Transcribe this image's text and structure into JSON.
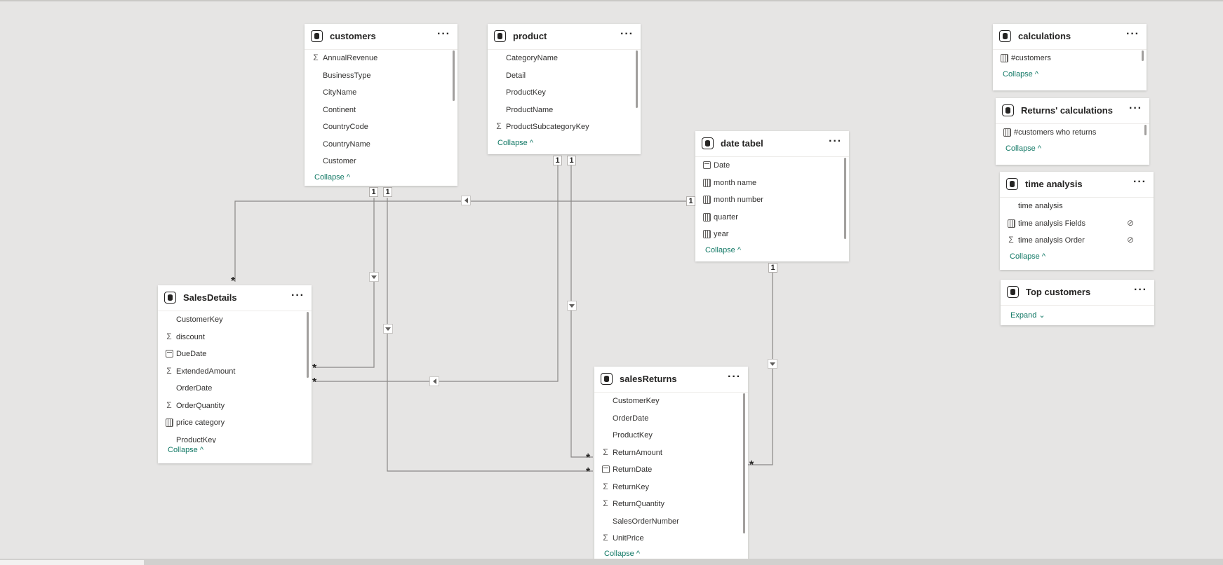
{
  "tables": {
    "customers": {
      "title": "customers",
      "fields": [
        {
          "name": "AnnualRevenue",
          "icon": "sigma"
        },
        {
          "name": "BusinessType",
          "icon": ""
        },
        {
          "name": "CityName",
          "icon": ""
        },
        {
          "name": "Continent",
          "icon": ""
        },
        {
          "name": "CountryCode",
          "icon": ""
        },
        {
          "name": "CountryName",
          "icon": ""
        },
        {
          "name": "Customer",
          "icon": ""
        }
      ],
      "toggle": "Collapse"
    },
    "product": {
      "title": "product",
      "fields": [
        {
          "name": "CategoryName",
          "icon": ""
        },
        {
          "name": "Detail",
          "icon": ""
        },
        {
          "name": "ProductKey",
          "icon": ""
        },
        {
          "name": "ProductName",
          "icon": ""
        },
        {
          "name": "ProductSubcategoryKey",
          "icon": "sigma"
        }
      ],
      "toggle": "Collapse"
    },
    "date_tabel": {
      "title": "date tabel",
      "fields": [
        {
          "name": "Date",
          "icon": "calendar"
        },
        {
          "name": "month name",
          "icon": "calc-column"
        },
        {
          "name": "month number",
          "icon": "calc-column"
        },
        {
          "name": "quarter",
          "icon": "calc-column"
        },
        {
          "name": "year",
          "icon": "calc-column"
        }
      ],
      "toggle": "Collapse"
    },
    "sales_details": {
      "title": "SalesDetails",
      "fields": [
        {
          "name": "CustomerKey",
          "icon": ""
        },
        {
          "name": "discount",
          "icon": "sigma"
        },
        {
          "name": "DueDate",
          "icon": "calendar"
        },
        {
          "name": "ExtendedAmount",
          "icon": "sigma"
        },
        {
          "name": "OrderDate",
          "icon": ""
        },
        {
          "name": "OrderQuantity",
          "icon": "sigma"
        },
        {
          "name": "price category",
          "icon": "calc-column"
        },
        {
          "name": "ProductKey",
          "icon": ""
        }
      ],
      "toggle": "Collapse"
    },
    "sales_returns": {
      "title": "salesReturns",
      "fields": [
        {
          "name": "CustomerKey",
          "icon": ""
        },
        {
          "name": "OrderDate",
          "icon": ""
        },
        {
          "name": "ProductKey",
          "icon": ""
        },
        {
          "name": "ReturnAmount",
          "icon": "sigma"
        },
        {
          "name": "ReturnDate",
          "icon": "calendar"
        },
        {
          "name": "ReturnKey",
          "icon": "sigma"
        },
        {
          "name": "ReturnQuantity",
          "icon": "sigma"
        },
        {
          "name": "SalesOrderNumber",
          "icon": ""
        },
        {
          "name": "UnitPrice",
          "icon": "sigma"
        }
      ],
      "toggle": "Collapse"
    },
    "calculations": {
      "title": "calculations",
      "fields": [
        {
          "name": "#customers",
          "icon": "measure"
        }
      ],
      "toggle": "Collapse"
    },
    "returns_calculations": {
      "title": "Returns' calculations",
      "fields": [
        {
          "name": "#customers who returns",
          "icon": "measure"
        }
      ],
      "toggle": "Collapse"
    },
    "time_analysis": {
      "title": "time analysis",
      "fields": [
        {
          "name": "time analysis",
          "icon": ""
        },
        {
          "name": "time analysis Fields",
          "icon": "calc-column",
          "hidden": true
        },
        {
          "name": "time analysis Order",
          "icon": "sigma",
          "hidden": true
        }
      ],
      "toggle": "Collapse"
    },
    "top_customers": {
      "title": "Top customers",
      "fields": [],
      "toggle": "Expand"
    }
  },
  "relationships": {
    "one": "1",
    "many": "*"
  },
  "icons": {
    "table": "database-icon",
    "more": "more-options-icon",
    "sigma": "sigma-icon",
    "calendar": "calendar-icon",
    "calc-column": "calculated-column-icon",
    "measure": "measure-icon",
    "hidden": "hidden-eye-icon"
  },
  "more_label": "···",
  "colors": {
    "canvas": "#e6e5e4",
    "card": "#ffffff",
    "toggle_text": "#117865",
    "line": "#605e5c"
  }
}
